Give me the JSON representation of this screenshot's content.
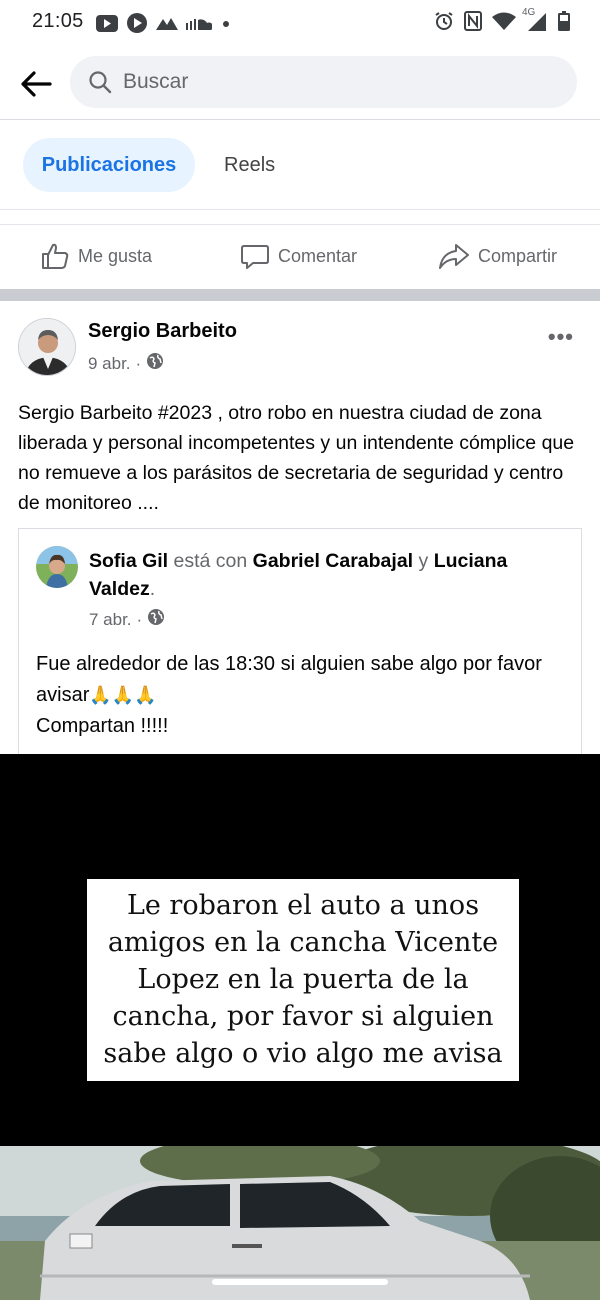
{
  "status_bar": {
    "time": "21:05",
    "network_label": "4G",
    "left_icons": [
      "youtube-icon",
      "play-icon",
      "signal-app-icon",
      "soundcloud-icon",
      "dot-icon"
    ],
    "right_icons": [
      "alarm-icon",
      "nfc-icon",
      "wifi-icon",
      "cell-signal-icon",
      "battery-icon"
    ]
  },
  "search": {
    "back_icon": "arrow-left-icon",
    "placeholder": "Buscar"
  },
  "tabs": [
    {
      "label": "Publicaciones",
      "active": true
    },
    {
      "label": "Reels",
      "active": false
    }
  ],
  "actions": {
    "like": "Me gusta",
    "comment": "Comentar",
    "share": "Compartir"
  },
  "post": {
    "author": "Sergio Barbeito",
    "date": "9 abr.",
    "separator": "·",
    "privacy_icon": "globe-icon",
    "more_icon": "more-dots-icon",
    "text": "Sergio Barbeito #2023 , otro robo en nuestra ciudad de zona liberada y personal incompetentes y un intendente cómplice que no remueve a los parásitos de secretaria de seguridad y centro de monitoreo  ...."
  },
  "shared_post": {
    "author": "Sofia Gil",
    "with_text": "está con",
    "tagged_1": "Gabriel Carabajal",
    "and_text": "y",
    "tagged_2": "Luciana Valdez",
    "period": ".",
    "date": "7 abr.",
    "separator": "·",
    "text_line_1": "Fue alrededor de las 18:30 si alguien sabe algo por favor avisar",
    "emojis": "🙏🙏🙏",
    "text_line_2": "Compartan !!!!!"
  },
  "media": {
    "caption": "Le robaron el auto a unos amigos en la cancha Vicente Lopez en la puerta de la cancha,  por favor si alguien sabe algo o vio algo me avisa"
  },
  "colors": {
    "brand_blue": "#1b74e4",
    "tab_active_bg": "#e7f3ff",
    "muted_text": "#65676b",
    "separator": "#c9ccd1"
  }
}
